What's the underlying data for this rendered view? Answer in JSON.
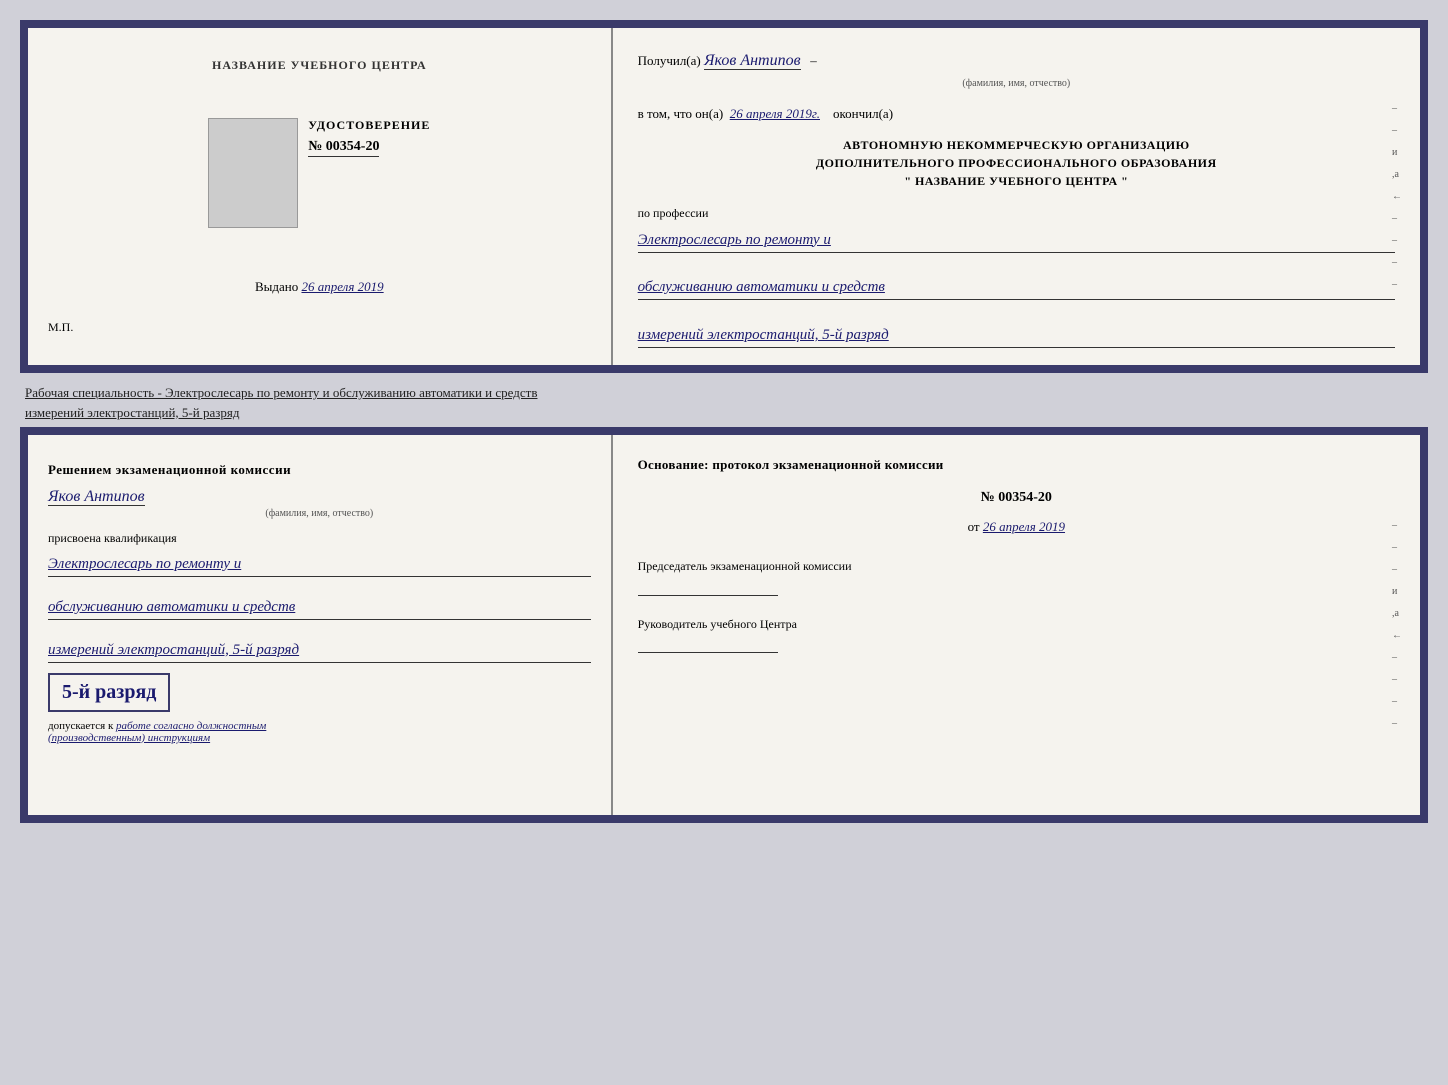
{
  "page": {
    "background": "#d0d0d8"
  },
  "top_cert": {
    "left": {
      "title": "НАЗВАНИЕ УЧЕБНОГО ЦЕНТРА",
      "cert_label": "УДОСТОВЕРЕНИЕ",
      "cert_number_prefix": "№",
      "cert_number": "00354-20",
      "issued_label": "Выдано",
      "issued_date": "26 апреля 2019",
      "mp_label": "М.П."
    },
    "right": {
      "received_label": "Получил(а)",
      "recipient_name": "Яков Антипов",
      "name_subtitle": "(фамилия, имя, отчество)",
      "that_label": "в том, что он(а)",
      "completion_date": "26 апреля 2019г.",
      "completed_label": "окончил(а)",
      "org_line1": "АВТОНОМНУЮ НЕКОММЕРЧЕСКУЮ ОРГАНИЗАЦИЮ",
      "org_line2": "ДОПОЛНИТЕЛЬНОГО ПРОФЕССИОНАЛЬНОГО ОБРАЗОВАНИЯ",
      "org_line3": "\"   НАЗВАНИЕ УЧЕБНОГО ЦЕНТРА   \"",
      "profession_label": "по профессии",
      "profession_line1": "Электрослесарь по ремонту и",
      "profession_line2": "обслуживанию автоматики и средств",
      "profession_line3": "измерений электростанций, 5-й разряд",
      "side_marks": [
        "–",
        "–",
        "и",
        ",а",
        "←",
        "–",
        "–",
        "–",
        "–"
      ]
    }
  },
  "separator": {
    "text_line1": "Рабочая специальность - Электрослесарь по ремонту и обслуживанию автоматики и средств",
    "text_line2": "измерений электростанций, 5-й разряд"
  },
  "bottom_cert": {
    "left": {
      "decision_text": "Решением экзаменационной комиссии",
      "person_name": "Яков Антипов",
      "name_subtitle": "(фамилия, имя, отчество)",
      "qual_assigned_label": "присвоена квалификация",
      "qual_line1": "Электрослесарь по ремонту и",
      "qual_line2": "обслуживанию автоматики и средств",
      "qual_line3": "измерений электростанций, 5-й разряд",
      "grade_label": "5-й разряд",
      "admission_prefix": "допускается к",
      "admission_text": "работе согласно должностным",
      "admission_text2": "(производственным) инструкциям"
    },
    "right": {
      "basis_label": "Основание: протокол экзаменационной комиссии",
      "protocol_prefix": "№",
      "protocol_number": "00354-20",
      "date_prefix": "от",
      "protocol_date": "26 апреля 2019",
      "chair_label": "Председатель экзаменационной комиссии",
      "director_label": "Руководитель учебного Центра",
      "side_marks": [
        "–",
        "–",
        "–",
        "и",
        ",а",
        "←",
        "–",
        "–",
        "–",
        "–"
      ]
    }
  }
}
